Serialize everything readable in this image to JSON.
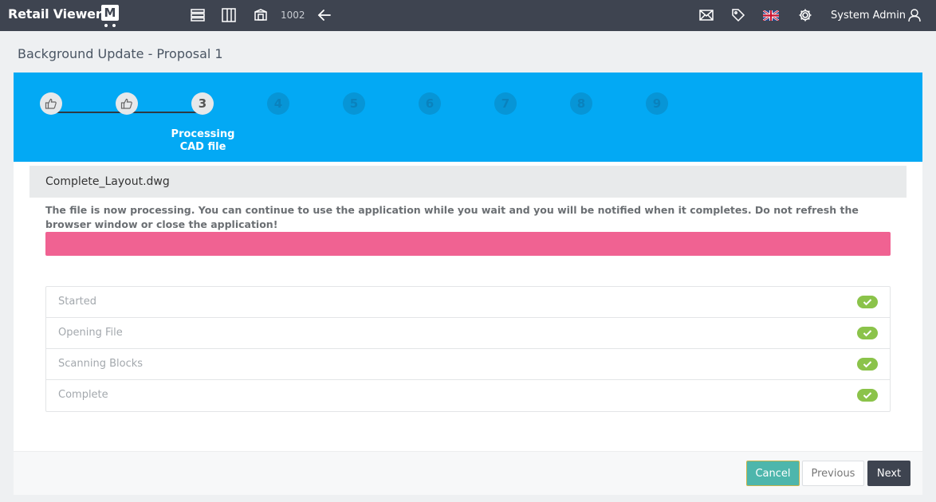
{
  "app": {
    "brand_text": "Retail Viewer",
    "brand_mark": "M",
    "record_number": "1002",
    "user_name": "System Admin"
  },
  "toolbar": {
    "icons": [
      "list-icon",
      "columns-icon",
      "box-icon",
      "back-arrow-icon",
      "mail-icon",
      "tag-icon",
      "uk-flag-icon",
      "gear-icon",
      "user-icon"
    ]
  },
  "page": {
    "title": "Background Update - Proposal 1"
  },
  "wizard": {
    "steps": [
      {
        "label": "",
        "status": "done"
      },
      {
        "label": "",
        "status": "done"
      },
      {
        "label": "3",
        "status": "active"
      },
      {
        "label": "4",
        "status": "future"
      },
      {
        "label": "5",
        "status": "future"
      },
      {
        "label": "6",
        "status": "future"
      },
      {
        "label": "7",
        "status": "future"
      },
      {
        "label": "8",
        "status": "future"
      },
      {
        "label": "9",
        "status": "future"
      }
    ],
    "active_step_title_line1": "Processing",
    "active_step_title_line2": "CAD file",
    "colors": {
      "header": "#03a9f4",
      "progress": "#f06292",
      "check": "#8bc34a"
    }
  },
  "file": {
    "name": "Complete_Layout.dwg",
    "notice": "The file is now processing. You can continue to use the application while you wait and you will be notified when it completes. Do not refresh the browser window or close the application!"
  },
  "status_items": [
    {
      "label": "Started",
      "complete": true
    },
    {
      "label": "Opening File",
      "complete": true
    },
    {
      "label": "Scanning Blocks",
      "complete": true
    },
    {
      "label": "Complete",
      "complete": true
    }
  ],
  "buttons": {
    "cancel": "Cancel",
    "previous": "Previous",
    "next": "Next"
  }
}
